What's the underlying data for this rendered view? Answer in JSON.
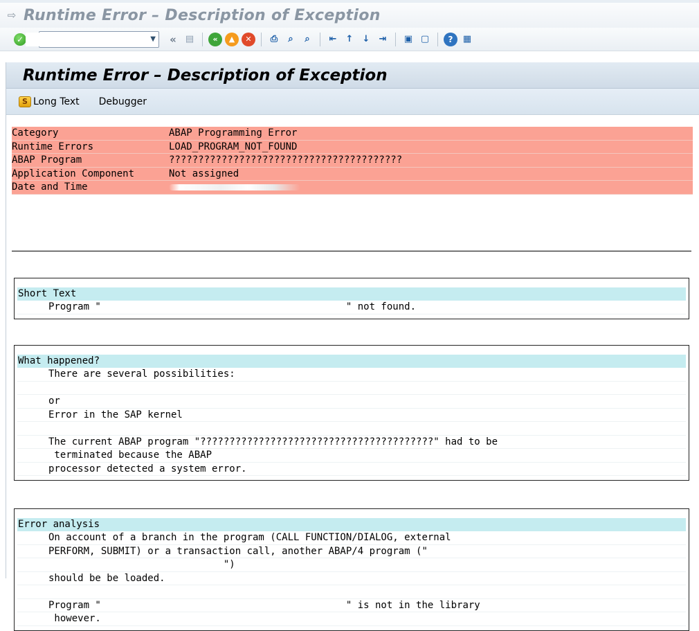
{
  "window": {
    "title": "Runtime Error – Description of Exception",
    "menu_icon": "menu-icon"
  },
  "toolbar": {
    "command_field_value": "",
    "icons": [
      "enter-icon",
      "back-icon",
      "exit-icon",
      "cancel-icon",
      "print-icon",
      "find-icon",
      "find-next-icon",
      "first-page-icon",
      "previous-page-icon",
      "next-page-icon",
      "last-page-icon",
      "create-session-icon",
      "shortcut-icon",
      "help-icon",
      "layout-icon"
    ]
  },
  "screen": {
    "title": "Runtime Error – Description of Exception",
    "buttons": {
      "long_text": "Long Text",
      "debugger": "Debugger"
    }
  },
  "info": {
    "rows": [
      {
        "label": "Category",
        "value": "ABAP Programming Error"
      },
      {
        "label": "Runtime Errors",
        "value": "LOAD_PROGRAM_NOT_FOUND"
      },
      {
        "label": "ABAP Program",
        "value": "????????????????????????????????????????"
      },
      {
        "label": "Application Component",
        "value": "Not assigned"
      },
      {
        "label": "Date and Time",
        "value": ""
      }
    ],
    "highlight_color": "#fba294"
  },
  "short_text": {
    "heading": "Short Text",
    "lines": [
      "Program \"                                          \" not found."
    ]
  },
  "what_happened": {
    "heading": "What happened?",
    "lines": [
      "There are several possibilities:",
      "",
      "or",
      "Error in the SAP kernel",
      "",
      "The current ABAP program \"????????????????????????????????????????\" had to be",
      " terminated because the ABAP",
      "processor detected a system error."
    ]
  },
  "error_analysis": {
    "heading": "Error analysis",
    "lines": [
      "On account of a branch in the program (CALL FUNCTION/DIALOG, external",
      "PERFORM, SUBMIT) or a transaction call, another ABAP/4 program (\"",
      "                              \")",
      "should be be loaded.",
      "",
      "Program \"                                          \" is not in the library",
      " however."
    ]
  },
  "colors": {
    "section_heading_bg": "#c5ecf0",
    "title_bar_bg": "#d7e3ee"
  }
}
